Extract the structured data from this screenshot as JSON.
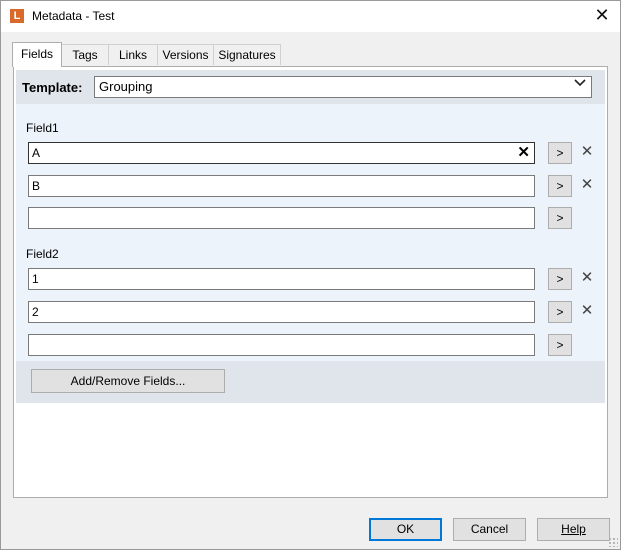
{
  "window": {
    "title": "Metadata - Test",
    "app_icon_letter": "L",
    "close_glyph": "✕"
  },
  "tabs": [
    {
      "label": "Fields",
      "active": true
    },
    {
      "label": "Tags",
      "active": false
    },
    {
      "label": "Links",
      "active": false
    },
    {
      "label": "Versions",
      "active": false
    },
    {
      "label": "Signatures",
      "active": false
    }
  ],
  "template": {
    "label": "Template:",
    "value": "Grouping"
  },
  "groups": [
    {
      "label": "Field1",
      "fields": [
        {
          "value": "A",
          "focused": true
        },
        {
          "value": "B",
          "focused": false
        },
        {
          "value": "",
          "focused": false
        }
      ]
    },
    {
      "label": "Field2",
      "fields": [
        {
          "value": "1",
          "focused": false
        },
        {
          "value": "2",
          "focused": false
        },
        {
          "value": "",
          "focused": false
        }
      ]
    }
  ],
  "arrow_label": ">",
  "add_remove_label": "Add/Remove Fields...",
  "buttons": {
    "ok": "OK",
    "cancel": "Cancel",
    "help": "Help"
  },
  "colors": {
    "accent": "#0078d7",
    "app_icon": "#d96a2b",
    "fields_bg": "#edf3fb",
    "bar_bg": "#dfe5eb"
  }
}
